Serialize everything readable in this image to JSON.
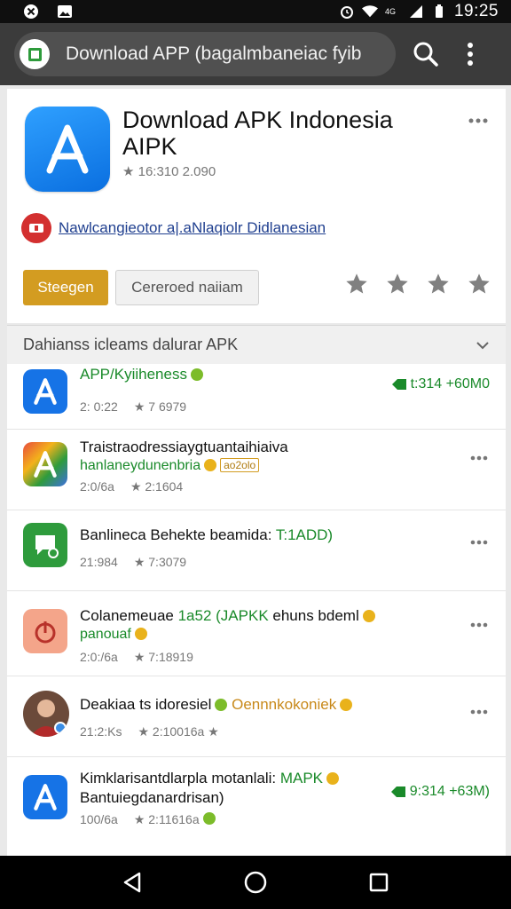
{
  "status_bar": {
    "time": "19:25",
    "network": "4G",
    "icons": [
      "x-notification-icon",
      "image-notification-icon",
      "alarm-icon",
      "wifi-icon",
      "signal-icon",
      "battery-icon"
    ]
  },
  "browser": {
    "url_text": "Download APP (bagalmbaneiac fyib",
    "favicon": "square-favicon-icon",
    "search_icon": "search-icon",
    "menu_icon": "more-vert-icon"
  },
  "app_card": {
    "title": "Download APK Indonesia AIPK",
    "meta": "★ 16:310 2.090",
    "developer_text": "Nawlcangieotor a|.aNlaqiolr Didlanesian",
    "primary_button": "Steegen",
    "secondary_button": "Cereroed naiiam",
    "rating_stars": 4,
    "accent": "#d39c21"
  },
  "section": {
    "title": "Dahianss icleams dalurar APK"
  },
  "items": [
    {
      "title": "APP/Kyiiheness",
      "subtitle": "",
      "meta_left": "2: 0:22",
      "meta_right": "★ 7 6979",
      "price": "t:314 +60M0",
      "icon": "app-store-a-icon",
      "icon_color": "#1673e6"
    },
    {
      "title": "Traistraodressiaygtuantaihiaiva",
      "subtitle": "hanlaneydunenbria",
      "tag": "ao2olo",
      "meta_left": "2:0/6a",
      "meta_right": "★ 2:1604",
      "icon": "rainbow-a-icon",
      "icon_color": "#e84b3c"
    },
    {
      "title": "Banlineca Behekte beamida:",
      "title_green": "T:1ADD)",
      "subtitle": "",
      "meta_left": "21:984",
      "meta_right": "★ 7:3079",
      "icon": "chat-bubble-icon",
      "icon_color": "#2e9b3c"
    },
    {
      "title": "Colanemeuae",
      "title_green": "1a52 (JAPKK",
      "title_tail": "ehuns bdeml",
      "subtitle": "panouaf",
      "meta_left": "2:0:/6a",
      "meta_right": "★ 7:18919",
      "icon": "music-note-icon",
      "icon_color": "#f08a5d"
    },
    {
      "title": "Deakiaa ts idoresiel",
      "title_green": "Oennnkokoniek",
      "subtitle": "",
      "meta_left": "21:2:Ks",
      "meta_right": "★ 2:10016a ★",
      "icon": "avatar-photo-icon",
      "icon_color": "#8a5a44"
    },
    {
      "title": "Kimklarisantdlarpla motanlali:",
      "title_green": "MAPK",
      "subtitle": "Bantuiegdanardrisan)",
      "meta_left": "100/6a",
      "meta_right": "★ 2:11616a",
      "price": "9:314 +63M)",
      "icon": "app-store-a-icon",
      "icon_color": "#1673e6"
    }
  ],
  "nav": {
    "back": "back-triangle-icon",
    "home": "home-circle-icon",
    "recents": "recents-square-icon"
  }
}
